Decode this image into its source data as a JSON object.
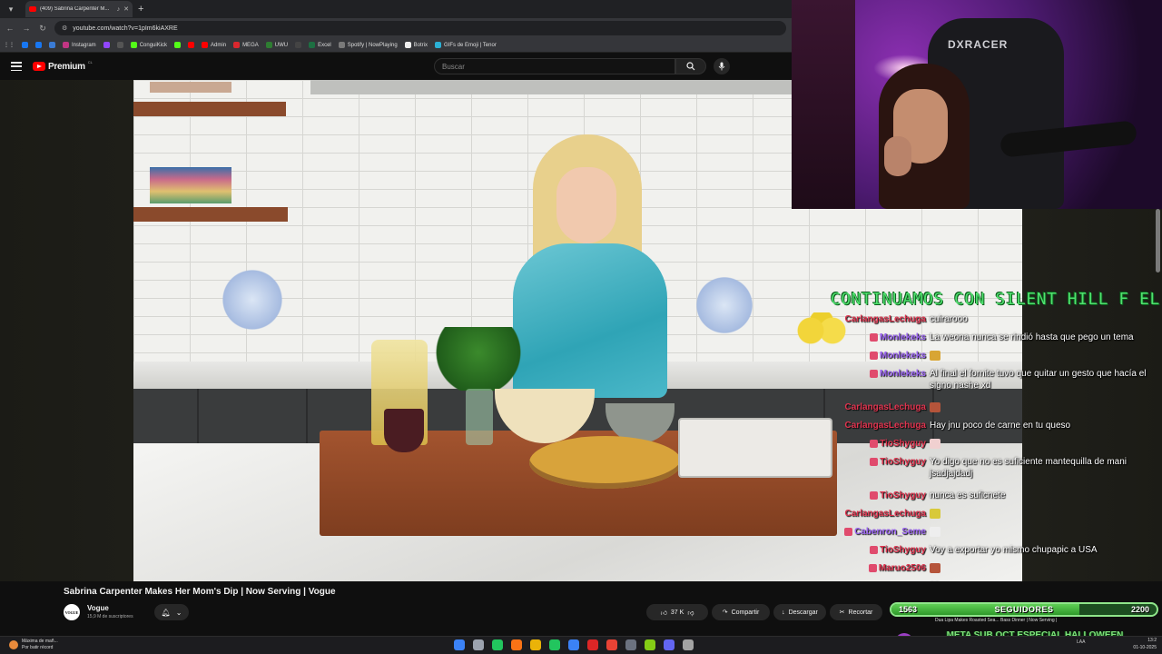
{
  "browser": {
    "tab_title": "(409) Sabrina Carpenter M...",
    "url": "youtube.com/watch?v=1pIm6kiAXRE",
    "bookmarks": [
      {
        "label": "",
        "color": "#1877f2"
      },
      {
        "label": "",
        "color": "#1877f2"
      },
      {
        "label": "",
        "color": "#3a7bd5"
      },
      {
        "label": "Instagram",
        "color": "#c13584"
      },
      {
        "label": "",
        "color": "#9146ff"
      },
      {
        "label": "",
        "color": "#555555"
      },
      {
        "label": "ConguiKick",
        "color": "#53fc18"
      },
      {
        "label": "",
        "color": "#53fc18"
      },
      {
        "label": "",
        "color": "#ff0000"
      },
      {
        "label": "Admin",
        "color": "#ff0000"
      },
      {
        "label": "MEGA",
        "color": "#d9272e"
      },
      {
        "label": "UWU",
        "color": "#2e7d32"
      },
      {
        "label": "",
        "color": "#444444"
      },
      {
        "label": "Excel",
        "color": "#1d6f42"
      },
      {
        "label": "Spotify | NowPlaying",
        "color": "#7a7a7a"
      },
      {
        "label": "Botrix",
        "color": "#eeeeee"
      },
      {
        "label": "GIFs de Emoji | Tenor",
        "color": "#2bb0d5"
      }
    ]
  },
  "youtube": {
    "logo_text": "Premium",
    "logo_country": "CL",
    "search_placeholder": "Buscar",
    "video_title": "Sabrina Carpenter Makes Her Mom's Dip | Now Serving | Vogue",
    "channel_name": "Vogue",
    "channel_avatar_text": "VOGUE",
    "subscribers": "15,9 M de suscriptores",
    "likes": "37 K",
    "share_label": "Compartir",
    "download_label": "Descargar",
    "clip_label": "Recortar"
  },
  "webcam": {
    "chair_brand": "DXRACER"
  },
  "overlay": {
    "banner": "CONTINUAMOS CON SILENT HILL F EL V",
    "chat": [
      {
        "user": "CarlangasLechuga",
        "color": "#e0344f",
        "text": "cuirarooo",
        "badge": "",
        "emote": ""
      },
      {
        "user": "Monlekeks",
        "color": "#9a63f2",
        "text": "La weona nunca se rindió hasta que pego un tema",
        "badge": "#e04b6d",
        "emote": ""
      },
      {
        "user": "Monlekeks",
        "color": "#9a63f2",
        "text": "",
        "badge": "#e04b6d",
        "emote": "#d8a534"
      },
      {
        "user": "Monlekeks",
        "color": "#9a63f2",
        "text": "Al final el fornite tuvo que quitar un gesto que hacía el signo nashe xd",
        "badge": "#e04b6d",
        "emote": ""
      },
      {
        "user": "CarlangasLechuga",
        "color": "#e0344f",
        "text": "",
        "badge": "",
        "emote": "#b5543a"
      },
      {
        "user": "CarlangasLechuga",
        "color": "#e0344f",
        "text": "Hay jnu poco de carne en tu queso",
        "badge": "",
        "emote": ""
      },
      {
        "user": "TioShyguy",
        "color": "#e0344f",
        "text": "",
        "badge": "#e04b6d",
        "emote": "#f0d0d0"
      },
      {
        "user": "TioShyguy",
        "color": "#e0344f",
        "text": "Yo digo que no es suficiente mantequilla de mani jsadjajdadj",
        "badge": "#e04b6d",
        "emote": ""
      },
      {
        "user": "TioShyguy",
        "color": "#e0344f",
        "text": "nunca es suficnete",
        "badge": "#e04b6d",
        "emote": ""
      },
      {
        "user": "CarlangasLechuga",
        "color": "#e0344f",
        "text": "",
        "badge": "",
        "emote": "#d8c93a"
      },
      {
        "user": "Cabenron_Seme",
        "color": "#9a63f2",
        "text": "",
        "badge": "#e04b6d",
        "emote": "#eeeeee"
      },
      {
        "user": "TioShyguy",
        "color": "#e0344f",
        "text": "Voy a exportar yo mismo chupapic a USA",
        "badge": "#e04b6d",
        "emote": ""
      },
      {
        "user": "Maruo2506",
        "color": "#e0344f",
        "text": "",
        "badge": "#e04b6d",
        "emote": "#b5543a"
      },
      {
        "user": "CarlangasLechuga",
        "color": "#e0344f",
        "text": "??",
        "badge": "",
        "emote": ""
      }
    ],
    "followers": {
      "current": 1563,
      "goal": 2200,
      "label": "SEGUIDORES"
    },
    "meta_sub": "META SUB OCT ESPECIAL HALLOWEEN",
    "meta_badge": "0",
    "recs": "Dua Lipa Makes Roasted Sea...  Bass Dinner | Now Serving |"
  },
  "taskbar": {
    "weather_line1": "Máxima de mañ...",
    "weather_line2": "Por batir récord",
    "tray_text": "LAA",
    "clock_time": "13:2",
    "clock_date": "01-10-2025",
    "icons": [
      "#3b82f6",
      "#9ca3af",
      "#22c55e",
      "#f97316",
      "#eab308",
      "#22c55e",
      "#3b82f6",
      "#dc2626",
      "#ea4335",
      "#6b7280",
      "#84cc16",
      "#6366f1",
      "#a3a3a3"
    ]
  }
}
